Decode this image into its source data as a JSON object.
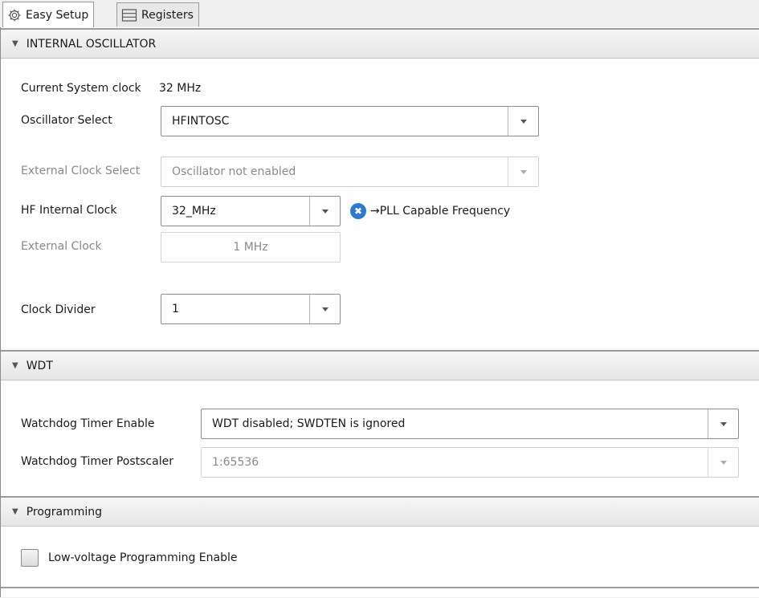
{
  "tabs": [
    {
      "label": "Easy Setup",
      "icon": "gear-icon",
      "active": true
    },
    {
      "label": "Registers",
      "icon": "list-icon",
      "active": false
    }
  ],
  "internal_oscillator": {
    "title": "INTERNAL OSCILLATOR",
    "current_clock_label": "Current System clock",
    "current_clock_value": "32 MHz",
    "oscillator_select": {
      "label": "Oscillator Select",
      "value": "HFINTOSC"
    },
    "external_clock_select": {
      "label": "External Clock Select",
      "value": "Oscillator not enabled"
    },
    "hf_internal_clock": {
      "label": "HF Internal Clock",
      "value": "32_MHz",
      "info": "→PLL Capable Frequency"
    },
    "external_clock": {
      "label": "External Clock",
      "value": "1 MHz"
    },
    "clock_divider": {
      "label": "Clock Divider",
      "value": "1"
    }
  },
  "wdt": {
    "title": "WDT",
    "timer_enable": {
      "label": "Watchdog Timer Enable",
      "value": "WDT disabled; SWDTEN is ignored"
    },
    "postscaler": {
      "label": "Watchdog Timer Postscaler",
      "value": "1:65536"
    }
  },
  "programming": {
    "title": "Programming",
    "lvp": {
      "label": "Low-voltage Programming Enable",
      "checked": false
    }
  },
  "colors": {
    "info_icon": "#2f7ad1",
    "section_border": "#9d9d9d"
  }
}
